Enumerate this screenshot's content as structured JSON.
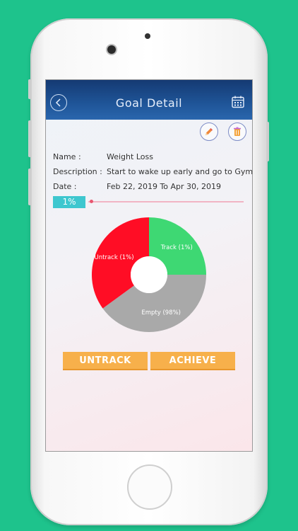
{
  "header": {
    "title": "Goal Detail"
  },
  "goal": {
    "name_label": "Name :",
    "name_value": "Weight Loss",
    "description_label": "Description :",
    "description_value": "Start to wake up early and go to Gym",
    "date_label": "Date :",
    "date_value": "Feb 22, 2019 To Apr 30, 2019"
  },
  "progress": {
    "label": "1%",
    "value": 0.01
  },
  "chart_data": {
    "type": "pie",
    "categories": [
      "Track (1%)",
      "Empty (98%)",
      "Untrack (1%)"
    ],
    "values": [
      25,
      40,
      35
    ],
    "colors": [
      "#3ed873",
      "#a9a9a9",
      "#ff0d25"
    ],
    "title": "",
    "legend": "none"
  },
  "buttons": {
    "untrack": "UNTRACK",
    "achieve": "ACHIEVE"
  },
  "colors": {
    "background": "#1ec38c",
    "header": "#1f5598",
    "accent": "#f7b04b",
    "progress": "#3ec7cf"
  }
}
